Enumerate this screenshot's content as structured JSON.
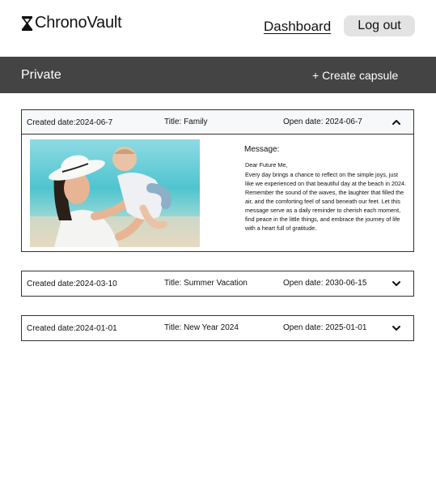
{
  "header": {
    "app_name": "ChronoVault",
    "logo_icon": "hourglass-icon",
    "nav_dashboard": "Dashboard",
    "logout_label": "Log out"
  },
  "section": {
    "title": "Private",
    "create_label": "+ Create capsule"
  },
  "capsules": [
    {
      "created": "Created date:2024-06-7",
      "title": "Title: Family",
      "open_date": "Open date: 2024-06-7",
      "expanded": true,
      "toggle_icon": "chevron-up-icon",
      "message_label": "Message:",
      "message_greeting": "Dear Future Me,",
      "message_body": "Every day brings a chance to reflect on the simple joys, just like we experienced on that beautiful day at the beach in 2024. Remember the sound of the waves, the laughter that filled the air, and the comforting feel of sand beneath our feet. Let this message serve as a daily reminder to cherish each moment, find peace in the little things, and embrace the journey of life with a heart full of gratitude."
    },
    {
      "created": "Created date:2024-03-10",
      "title": "Title: Summer Vacation",
      "open_date": "Open date: 2030-06-15",
      "expanded": false,
      "toggle_icon": "chevron-down-icon"
    },
    {
      "created": "Created date:2024-01-01",
      "title": "Title: New Year 2024",
      "open_date": "Open date: 2025-01-01",
      "expanded": false,
      "toggle_icon": "chevron-down-icon"
    }
  ],
  "colors": {
    "section_bar": "#444444",
    "logout_bg": "#e3e3e3",
    "border": "#333333"
  }
}
